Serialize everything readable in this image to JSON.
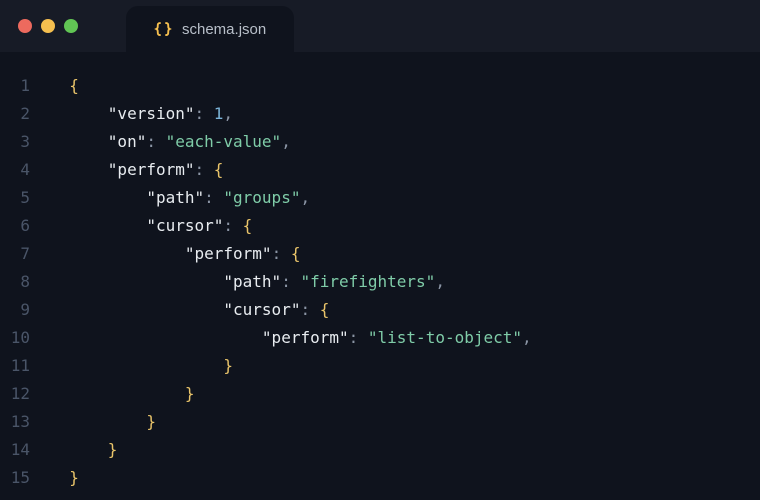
{
  "tab": {
    "filename": "schema.json"
  },
  "gutter": {
    "lines": [
      "1",
      "2",
      "3",
      "4",
      "5",
      "6",
      "7",
      "8",
      "9",
      "10",
      "11",
      "12",
      "13",
      "14",
      "15"
    ]
  },
  "code": {
    "l1_open": "{",
    "l2_key": "\"version\"",
    "l2_val": "1",
    "l3_key": "\"on\"",
    "l3_val": "\"each-value\"",
    "l4_key": "\"perform\"",
    "l4_brace": "{",
    "l5_key": "\"path\"",
    "l5_val": "\"groups\"",
    "l6_key": "\"cursor\"",
    "l6_brace": "{",
    "l7_key": "\"perform\"",
    "l7_brace": "{",
    "l8_key": "\"path\"",
    "l8_val": "\"firefighters\"",
    "l9_key": "\"cursor\"",
    "l9_brace": "{",
    "l10_key": "\"perform\"",
    "l10_val": "\"list-to-object\"",
    "l11_close": "}",
    "l12_close": "}",
    "l13_close": "}",
    "l14_close": "}",
    "l15_close": "}"
  }
}
